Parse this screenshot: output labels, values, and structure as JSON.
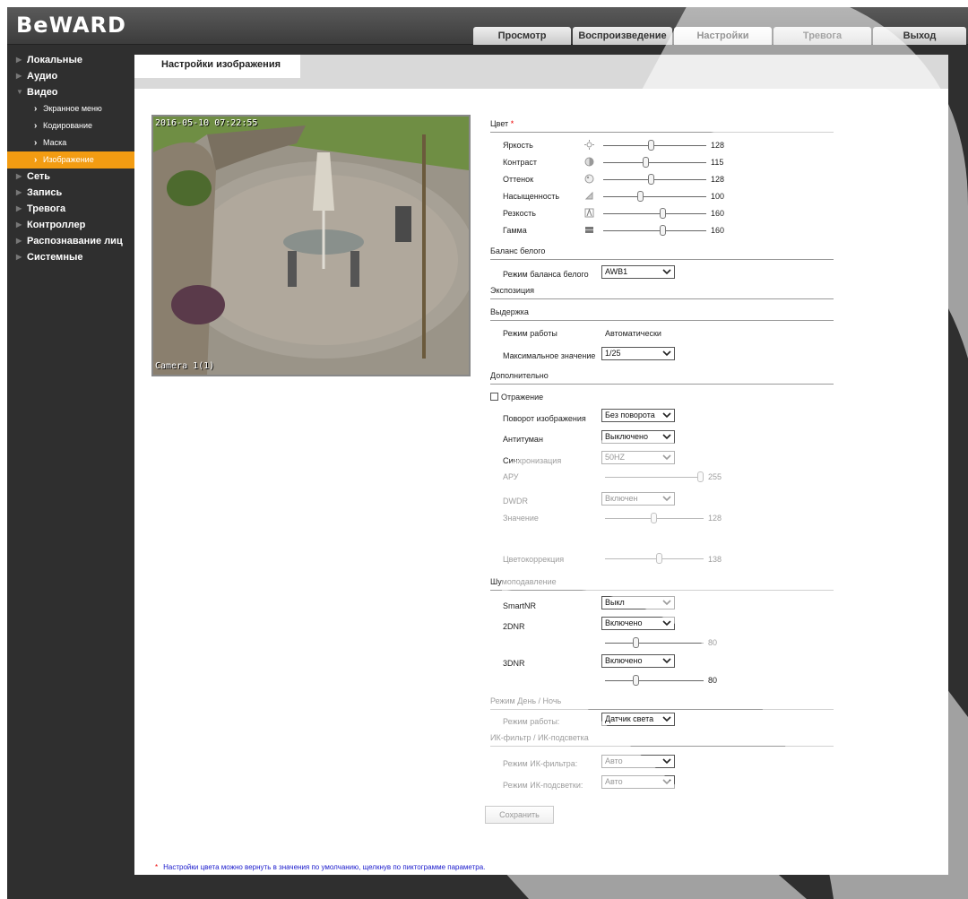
{
  "logo": "BeWARD",
  "nav": {
    "tabs": [
      "Просмотр",
      "Воспроизведение",
      "Настройки",
      "Тревога",
      "Выход"
    ],
    "active": "Настройки"
  },
  "sidebar": {
    "items": [
      {
        "label": "Локальные"
      },
      {
        "label": "Аудио"
      },
      {
        "label": "Видео",
        "expanded": true,
        "children": [
          "Экранное меню",
          "Кодирование",
          "Маска",
          "Изображение"
        ],
        "active_child": "Изображение"
      },
      {
        "label": "Сеть"
      },
      {
        "label": "Запись"
      },
      {
        "label": "Тревога"
      },
      {
        "label": "Контроллер"
      },
      {
        "label": "Распознавание лиц"
      },
      {
        "label": "Системные"
      }
    ]
  },
  "content": {
    "tab_title": "Настройки изображения",
    "camera": {
      "timestamp": "2016-05-10 07:22:55",
      "name": "Camera 1(1)"
    },
    "color": {
      "title": "Цвет",
      "sliders": [
        {
          "label": "Яркость",
          "value": 128,
          "max": 255
        },
        {
          "label": "Контраст",
          "value": 115,
          "max": 255
        },
        {
          "label": "Оттенок",
          "value": 128,
          "max": 255
        },
        {
          "label": "Насыщенность",
          "value": 100,
          "max": 255
        },
        {
          "label": "Резкость",
          "value": 160,
          "max": 255
        },
        {
          "label": "Гамма",
          "value": 160,
          "max": 255
        }
      ]
    },
    "white_balance": {
      "title": "Баланс белого",
      "mode_label": "Режим баланса белого",
      "mode_value": "AWB1"
    },
    "exposure": {
      "title": "Экспозиция"
    },
    "shutter": {
      "title": "Выдержка",
      "mode_label": "Режим работы",
      "mode_value": "Автоматически",
      "max_label": "Максимальное значение",
      "max_value": "1/25"
    },
    "additional": {
      "title": "Дополнительно",
      "mirror_label": "Отражение",
      "mirror_checked": false,
      "rotate_label": "Поворот изображения",
      "rotate_value": "Без поворота",
      "defog_label": "Антитуман",
      "defog_value": "Выключено",
      "sync_label": "Синхронизация",
      "sync_value": "50HZ",
      "agc_label": "АРУ",
      "agc_value": 255,
      "dwdr_label": "DWDR",
      "dwdr_value": "Включен",
      "dwdr_level_label": "Значение",
      "dwdr_level_value": 128,
      "cc_label": "Цветокоррекция",
      "cc_value": 138
    },
    "noise": {
      "title": "Шумоподавление",
      "smartnr_label": "SmartNR",
      "smartnr_value": "Выкл",
      "dnr2_label": "2DNR",
      "dnr2_value": "Включено",
      "dnr2_level": 80,
      "dnr3_label": "3DNR",
      "dnr3_value": "Включено",
      "dnr3_level": 80
    },
    "daynight": {
      "title": "Режим День / Ночь",
      "mode_label": "Режим работы:",
      "mode_value": "Датчик света"
    },
    "ir": {
      "title": "ИК-фильтр / ИК-подсветка",
      "filter_label": "Режим ИК-фильтра:",
      "filter_value": "Авто",
      "light_label": "Режим ИК-подсветки:",
      "light_value": "Авто"
    },
    "save_label": "Сохранить",
    "footnote": "Настройки цвета можно вернуть в значения по умолчанию, щелкнув по пиктограмме параметра.",
    "footnote_mark": "*",
    "required_mark": "*"
  },
  "colors": {
    "accent": "#f39c12",
    "background": "#2f2f2f",
    "link": "#1a1acc",
    "required": "#ee0000"
  }
}
